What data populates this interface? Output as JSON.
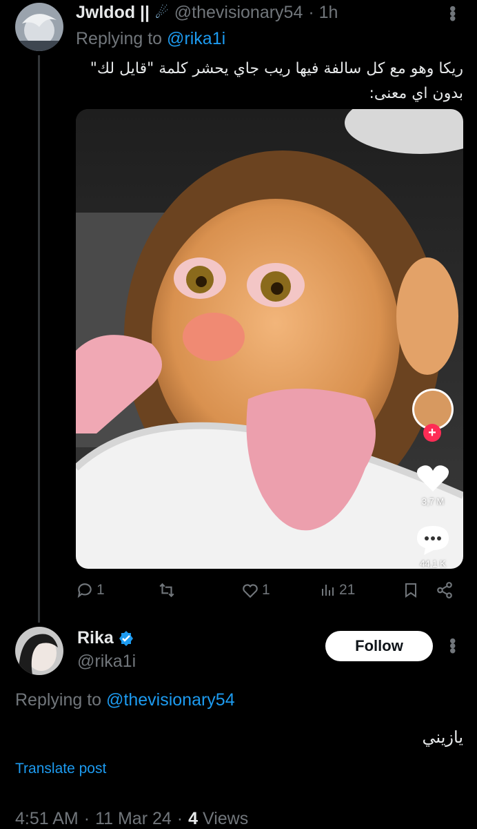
{
  "tweet1": {
    "display_name": "Jwldod ||",
    "name_emoji": "☄",
    "handle": "@thevisionary54",
    "time": "· 1h",
    "replying_prefix": "Replying to",
    "replying_handle": "@rika1i",
    "text_line1": "ريكا وهو مع كل سالفة فيها ريب جاي يحشر كلمة \"قايل لك\"",
    "text_line2": "بدون اي معنى:",
    "video_overlay": {
      "likes": "3,7 M",
      "comments": "44,1 K",
      "plus": "+"
    },
    "actions": {
      "replies": "1",
      "reposts": "",
      "likes": "1",
      "views": "21"
    },
    "icons": [
      "reply-icon",
      "repost-icon",
      "like-icon",
      "views-icon",
      "bookmark-icon",
      "share-icon",
      "more-icon"
    ]
  },
  "tweet2": {
    "display_name": "Rika",
    "handle": "@rika1i",
    "follow_label": "Follow",
    "replying_prefix": "Replying to",
    "replying_handle": "@thevisionary54",
    "text": "يازيني",
    "translate_label": "Translate post",
    "time": "4:51 AM",
    "date": "11 Mar 24",
    "views_count": "4",
    "views_label": "Views",
    "sep": "·"
  },
  "colors": {
    "background": "#000000",
    "text": "#e7e9ea",
    "muted": "#71767b",
    "accent": "#1d9bf0",
    "verified": "#1d9bf0"
  }
}
